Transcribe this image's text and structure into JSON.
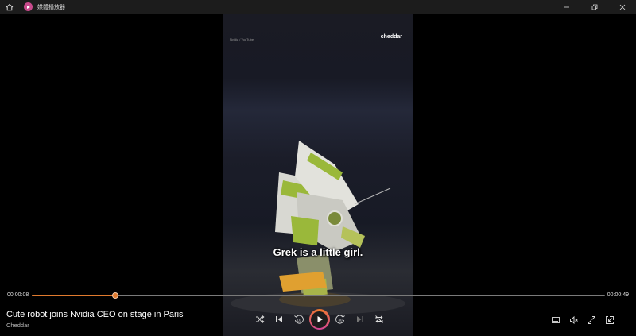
{
  "window": {
    "title": "媒體播放器",
    "icons": [
      "home-icon",
      "media-player-app-icon",
      "minimize-icon",
      "restore-icon",
      "close-icon"
    ]
  },
  "video": {
    "credit": "Nvidia / YouTube",
    "logo": "cheddar",
    "subtitle": "Grek is a little girl."
  },
  "playback": {
    "current_time": "00:00:08",
    "total_time": "00:00:49",
    "progress": 0.146
  },
  "media": {
    "title": "Cute robot joins Nvidia CEO on stage in Paris",
    "channel": "Cheddar"
  },
  "controls": {
    "center": [
      "shuffle-icon",
      "previous-icon",
      "rewind-10-icon",
      "play-icon",
      "forward-30-icon",
      "next-icon",
      "repeat-off-icon"
    ],
    "right": [
      "captions-icon",
      "mute-icon",
      "fullscreen-icon",
      "mini-player-icon"
    ]
  },
  "colors": {
    "accent": "#e07a2e",
    "play_ring": "#d4449a"
  }
}
